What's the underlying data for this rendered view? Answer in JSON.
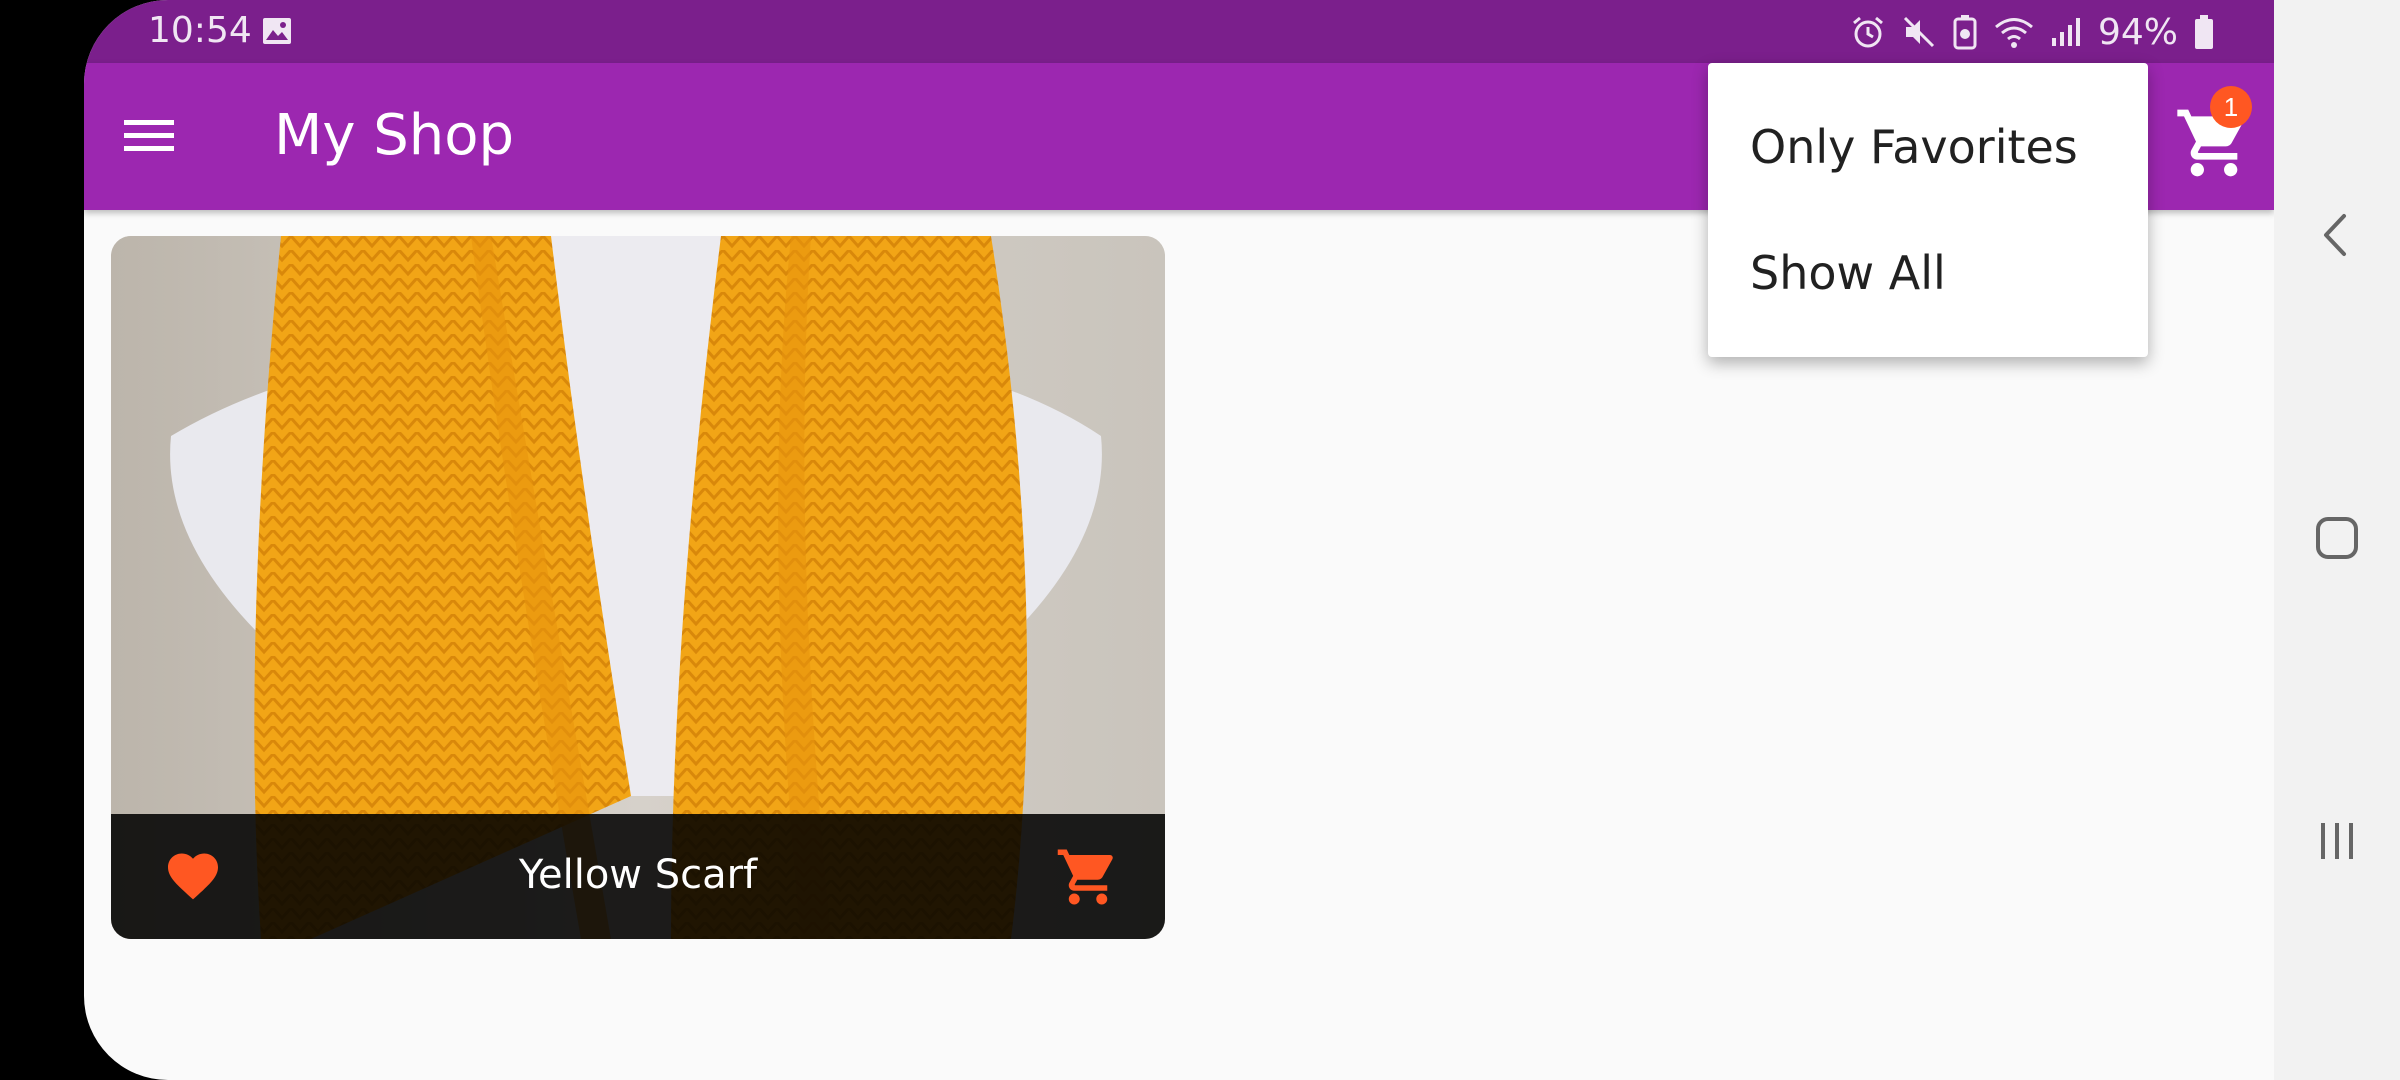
{
  "status_bar": {
    "time": "10:54",
    "battery_percent": "94%",
    "icons": [
      "image-icon",
      "alarm-icon",
      "mute-icon",
      "battery-saver-icon",
      "wifi-icon",
      "signal-icon",
      "battery-icon"
    ]
  },
  "app_bar": {
    "title": "My Shop",
    "cart_badge_count": "1",
    "background_color": "#9c27b0"
  },
  "popup_menu": {
    "items": [
      {
        "label": "Only Favorites"
      },
      {
        "label": "Show All"
      }
    ]
  },
  "products": [
    {
      "title": "Yellow Scarf",
      "is_favorite": true,
      "accent_color": "#ff5722"
    }
  ],
  "nav_bar": {
    "buttons": [
      "back-icon",
      "home-icon",
      "recents-icon"
    ]
  }
}
